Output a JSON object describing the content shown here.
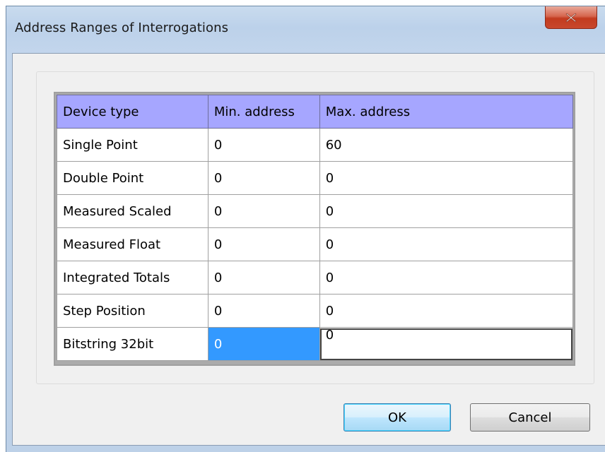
{
  "dialog": {
    "title": "Address Ranges of  Interrogations",
    "close_icon": "close-icon"
  },
  "table": {
    "headers": [
      "Device type",
      "Min. address",
      "Max. address"
    ],
    "rows": [
      {
        "type": "Single Point",
        "min": "0",
        "max": "60"
      },
      {
        "type": "Double Point",
        "min": "0",
        "max": "0"
      },
      {
        "type": "Measured Scaled",
        "min": "0",
        "max": "0"
      },
      {
        "type": "Measured Float",
        "min": "0",
        "max": "0"
      },
      {
        "type": "Integrated Totals",
        "min": "0",
        "max": "0"
      },
      {
        "type": "Step Position",
        "min": "0",
        "max": "0"
      },
      {
        "type": "Bitstring 32bit",
        "min": "0",
        "max": "0"
      }
    ],
    "header_color": "#a6a6ff",
    "selection_color": "#3399ff"
  },
  "buttons": {
    "ok_label": "OK",
    "cancel_label": "Cancel"
  }
}
